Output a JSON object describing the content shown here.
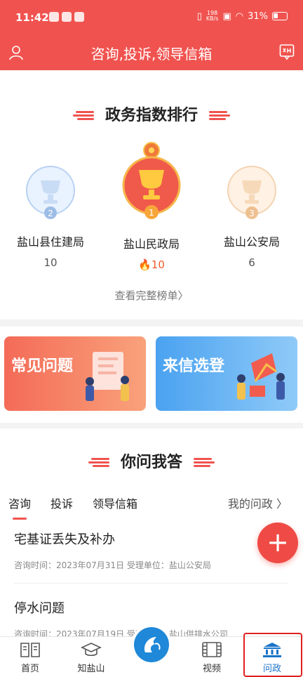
{
  "status": {
    "time": "11:42",
    "net_speed_top": "198",
    "net_speed_bottom": "KB/s",
    "battery": "31%"
  },
  "header": {
    "title": "咨询,投诉,领导信箱"
  },
  "ranking": {
    "title": "政务指数排行",
    "items": [
      {
        "rank": "2",
        "name": "盐山县住建局",
        "score": "10"
      },
      {
        "rank": "1",
        "name": "盐山民政局",
        "score": "10"
      },
      {
        "rank": "3",
        "name": "盐山公安局",
        "score": "6"
      }
    ],
    "more_label": "查看完整榜单"
  },
  "cards": {
    "faq": "常见问题",
    "selected": "来信选登"
  },
  "qa": {
    "title": "你问我答",
    "tabs": [
      "咨询",
      "投诉",
      "领导信箱"
    ],
    "my_label": "我的问政",
    "items": [
      {
        "title": "宅基证丢失及补办",
        "meta": "咨询时间：2023年07月31日    受理单位：盐山公安局"
      },
      {
        "title": "停水问题",
        "meta": "咨询时间：2023年07月19日    受理单位：盐山供排水公司"
      }
    ]
  },
  "fab": {
    "label": "+"
  },
  "nav": {
    "home": "首页",
    "know": "知盐山",
    "video": "视频",
    "wenzheng": "问政"
  },
  "colors": {
    "primary": "#f0534f",
    "active_nav": "#1a73c8"
  }
}
